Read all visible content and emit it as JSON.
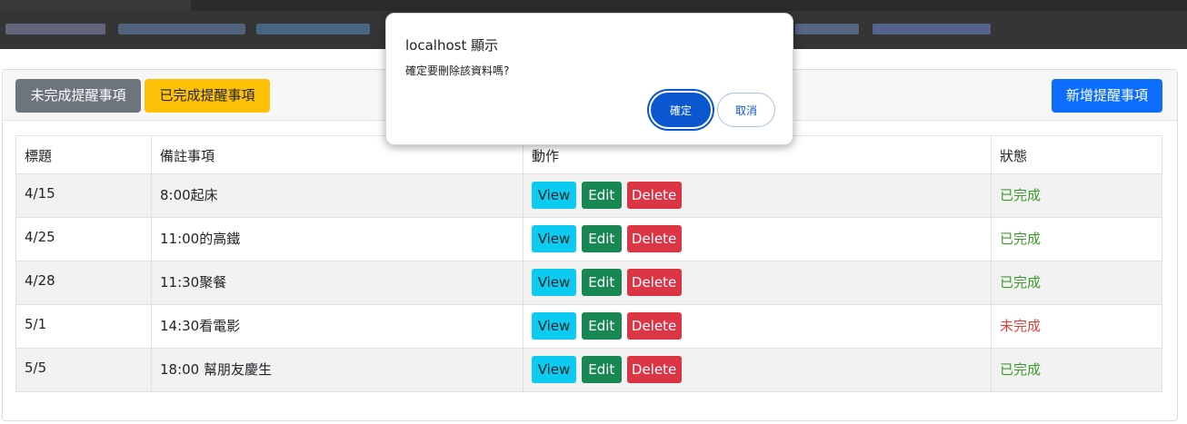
{
  "dialog": {
    "title": "localhost 顯示",
    "message": "確定要刪除該資料嗎?",
    "ok_label": "確定",
    "cancel_label": "取消"
  },
  "toolbar": {
    "incomplete_label": "未完成提醒事項",
    "complete_label": "已完成提醒事項",
    "add_label": "新增提醒事項"
  },
  "table": {
    "headers": [
      "標題",
      "備註事項",
      "動作",
      "狀態"
    ],
    "action_labels": {
      "view": "View",
      "edit": "Edit",
      "delete": "Delete"
    },
    "rows": [
      {
        "title": "4/15",
        "note": "8:00起床",
        "status": "已完成"
      },
      {
        "title": "4/25",
        "note": "11:00的高鐵",
        "status": "已完成"
      },
      {
        "title": "4/28",
        "note": "11:30聚餐",
        "status": "已完成"
      },
      {
        "title": "5/1",
        "note": "14:30看電影",
        "status": "未完成"
      },
      {
        "title": "5/5",
        "note": "18:00 幫朋友慶生",
        "status": "已完成"
      }
    ]
  },
  "colors": {
    "done": "#3c9a2a",
    "not_done": "#e0403b",
    "primary": "#0d6efd",
    "info": "#0dcaf0",
    "success": "#198754",
    "danger": "#dc3545"
  }
}
